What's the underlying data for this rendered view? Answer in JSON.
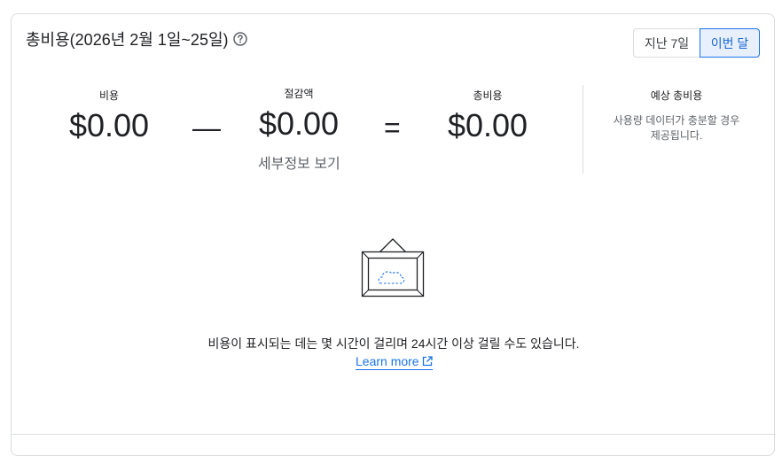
{
  "card": {
    "title": "총비용(2026년 2월 1일~25일)",
    "help_icon": "help-circle-icon"
  },
  "period_toggle": {
    "options": [
      "지난 7일",
      "이번 달"
    ],
    "selected": "이번 달"
  },
  "summary": {
    "cost": {
      "label": "비용",
      "value": "$0.00"
    },
    "minus_sign": "—",
    "savings": {
      "label": "절감액",
      "value": "$0.00",
      "details_link": "세부정보 보기"
    },
    "equals_sign": "=",
    "total": {
      "label": "총비용",
      "value": "$0.00"
    }
  },
  "forecast": {
    "label": "예상 총비용",
    "description_line1": "사용량 데이터가 충분할 경우",
    "description_line2": "제공됩니다."
  },
  "empty_state": {
    "illustration": "framed-cloud-illustration",
    "message": "비용이 표시되는 데는 몇 시간이 걸리며 24시간 이상 걸릴 수도 있습니다.",
    "learn_more": "Learn more",
    "learn_more_icon": "external-link-icon"
  },
  "colors": {
    "accent": "#1a73e8",
    "selected_bg": "#e8f0fe",
    "border": "#dadce0",
    "text": "#202124",
    "secondary_text": "#5f6368"
  }
}
